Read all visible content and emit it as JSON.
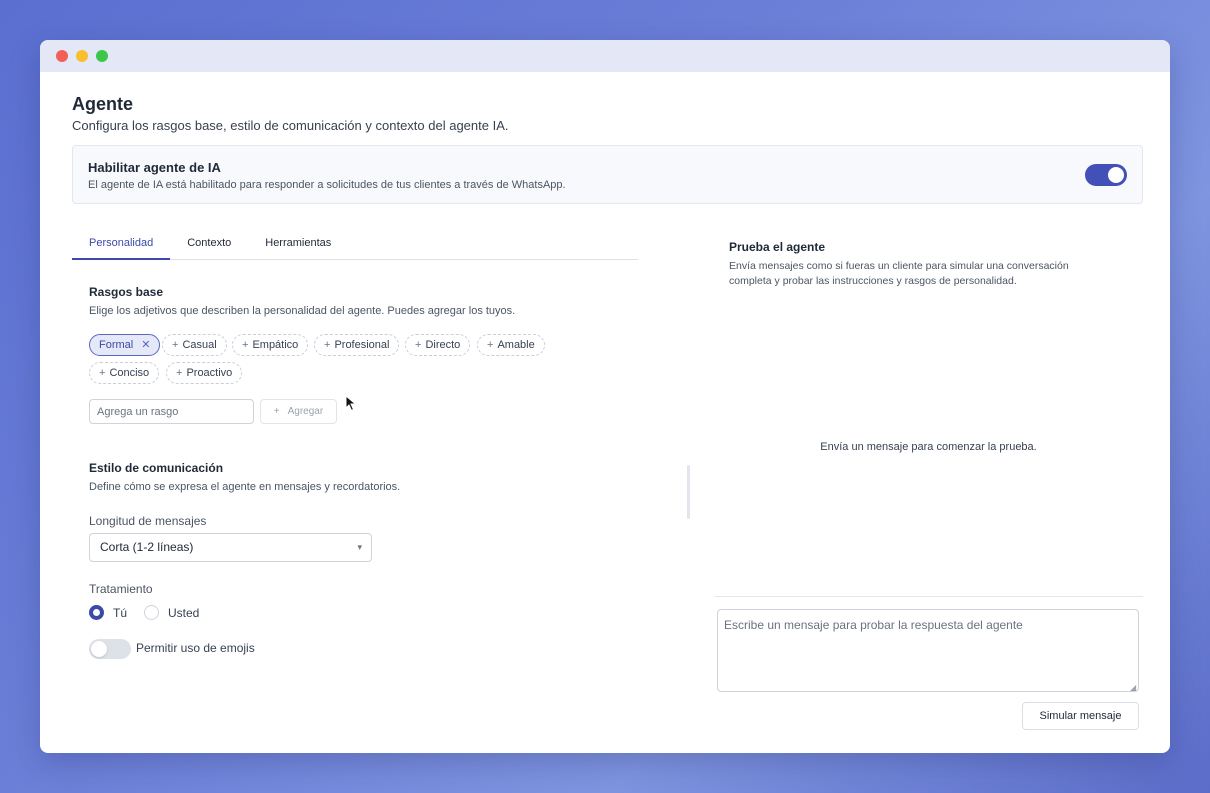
{
  "window": {
    "controls": [
      "close",
      "minimize",
      "maximize"
    ]
  },
  "header": {
    "title": "Agente",
    "subtitle": "Configura los rasgos base, estilo de comunicación y contexto del agente IA."
  },
  "enable_card": {
    "title": "Habilitar agente de IA",
    "description": "El agente de IA está habilitado para responder a solicitudes de tus clientes a través de WhatsApp.",
    "enabled": true
  },
  "tabs": [
    {
      "label": "Personalidad",
      "active": true
    },
    {
      "label": "Contexto",
      "active": false
    },
    {
      "label": "Herramientas",
      "active": false
    }
  ],
  "traits": {
    "title": "Rasgos base",
    "description": "Elige los adjetivos que describen la personalidad del agente. Puedes agregar los tuyos.",
    "chips": [
      {
        "label": "Formal",
        "selected": true
      },
      {
        "label": "Casual",
        "selected": false
      },
      {
        "label": "Empático",
        "selected": false
      },
      {
        "label": "Profesional",
        "selected": false
      },
      {
        "label": "Directo",
        "selected": false
      },
      {
        "label": "Amable",
        "selected": false
      },
      {
        "label": "Conciso",
        "selected": false
      },
      {
        "label": "Proactivo",
        "selected": false
      }
    ],
    "input_placeholder": "Agrega un rasgo",
    "add_label": "Agregar"
  },
  "communication": {
    "title": "Estilo de comunicación",
    "description": "Define cómo se expresa el agente en mensajes y recordatorios.",
    "length_label": "Longitud de mensajes",
    "length_value": "Corta (1-2 líneas)",
    "treatment_label": "Tratamiento",
    "treatment_options": [
      {
        "label": "Tú",
        "checked": true
      },
      {
        "label": "Usted",
        "checked": false
      }
    ],
    "emoji_label": "Permitir uso de emojis",
    "emoji_enabled": false
  },
  "test_panel": {
    "title": "Prueba el agente",
    "description": "Envía mensajes como si fueras un cliente para simular una conversación completa y probar las instrucciones y rasgos de personalidad.",
    "empty_message": "Envía un mensaje para comenzar la prueba.",
    "input_placeholder": "Escribe un mensaje para probar la respuesta del agente",
    "simulate_label": "Simular mensaje"
  },
  "colors": {
    "accent": "#3b4aa8",
    "toggle_on": "#4350b8",
    "chip_selected_bg": "#e5e8f7"
  }
}
